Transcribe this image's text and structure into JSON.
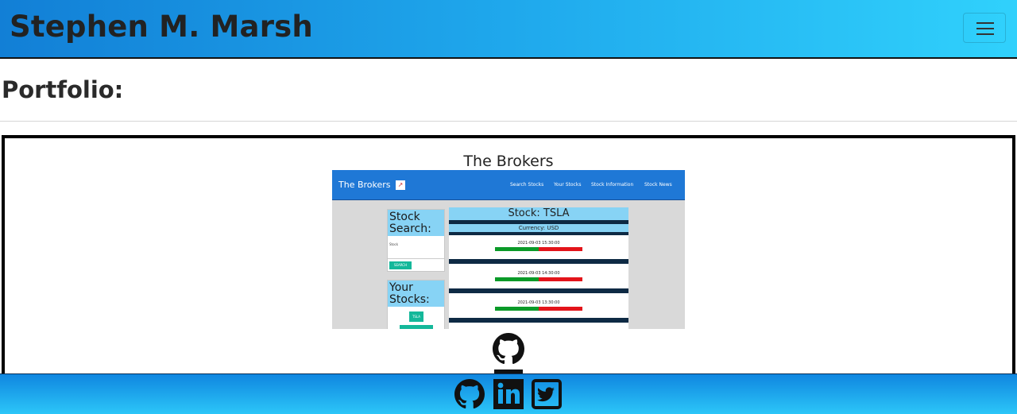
{
  "navbar": {
    "brand": "Stephen M. Marsh",
    "menu_icon": "hamburger-menu-icon"
  },
  "section": {
    "title": "Portfolio:"
  },
  "project": {
    "title": "The Brokers",
    "screenshot": {
      "brand": "The Brokers",
      "brand_icon": "chart-icon",
      "nav_links": [
        "Search Stocks",
        "Your Stocks",
        "Stock Information",
        "Stock News"
      ],
      "search_card": {
        "title_line1": "Stock",
        "title_line2": "Search:",
        "input_label": "Stock",
        "button": "SEARCH"
      },
      "stocks_card": {
        "title_line1": "Your",
        "title_line2": "Stocks:",
        "ticker": "TSLA"
      },
      "stock_panel": {
        "title": "Stock: TSLA",
        "currency": "Currency: USD",
        "entries": [
          {
            "time": "2021-09-03 15:30:00"
          },
          {
            "time": "2021-09-03 14:30:00"
          },
          {
            "time": "2021-09-03 13:30:00"
          }
        ]
      }
    },
    "link_icon": "github-icon"
  },
  "footer": {
    "icons": [
      "github-icon",
      "linkedin-icon",
      "twitter-icon"
    ]
  },
  "colors": {
    "nav_start": "#127fd6",
    "nav_end": "#30d1fc",
    "accent_teal": "#14b89a",
    "price_up": "#0a9a28",
    "price_down": "#e3141a"
  }
}
